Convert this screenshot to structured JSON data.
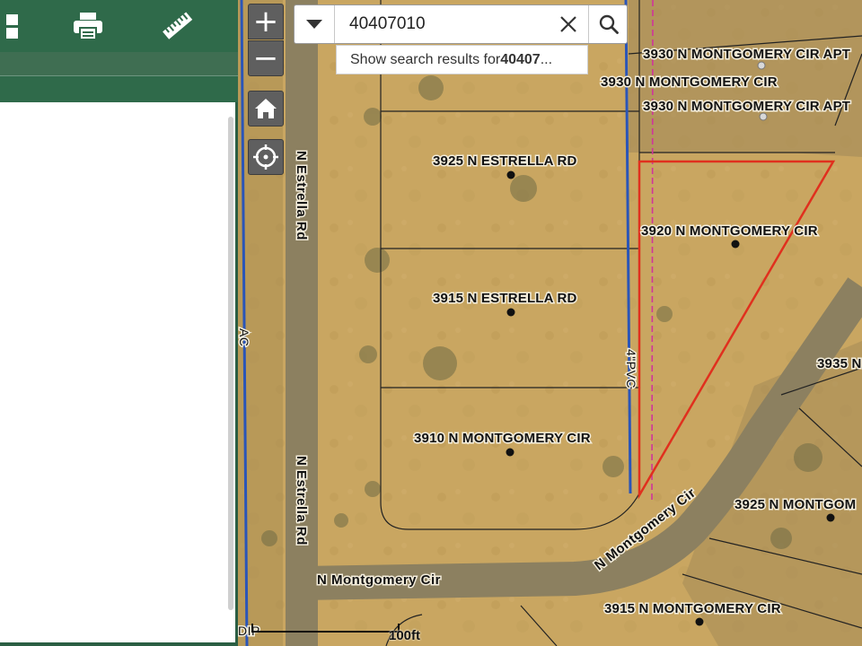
{
  "search": {
    "value": "40407010",
    "suggestion_prefix": "Show search results for ",
    "suggestion_bold": "40407",
    "suggestion_suffix": "..."
  },
  "map_controls": {
    "zoom_in": "+",
    "zoom_out": "−"
  },
  "parcel_labels": [
    "3930 N MONTGOMERY CIR APT",
    "3930 N MONTGOMERY CIR",
    "3930 N MONTGOMERY CIR APT",
    "3925 N ESTRELLA RD",
    "3920 N MONTGOMERY CIR",
    "3915 N ESTRELLA RD",
    "3935 N",
    "3910 N MONTGOMERY CIR",
    "3925 N MONTGOM",
    "3915 N MONTGOMERY CIR"
  ],
  "street_labels": {
    "estrella_upper": "N Estrella Rd",
    "estrella_lower": "N Estrella Rd",
    "montgomery_horizontal": "N Montgomery Cir",
    "montgomery_diagonal": "N Montgomery Cir"
  },
  "utility_labels": {
    "pvc": "4\"PVC",
    "ac": "AC",
    "dip": "DIP"
  },
  "scale": {
    "label": "100ft"
  },
  "colors": {
    "panel_green": "#2f6a4a",
    "selection_red": "#e0301e",
    "water_line_blue": "#2a55b8",
    "boundary_magenta": "#d0359a"
  }
}
